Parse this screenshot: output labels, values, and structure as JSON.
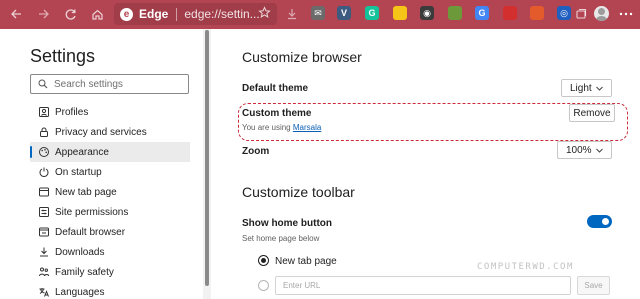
{
  "browser": {
    "brand": "Edge",
    "address_text": "edge://settin...",
    "extensions": [
      {
        "name": "mail-extension-icon",
        "glyph": "✉",
        "color": "#6b6b6b"
      },
      {
        "name": "vpn-extension-icon",
        "glyph": "V",
        "color": "#3d5a80"
      },
      {
        "name": "grammarly-extension-icon",
        "glyph": "G",
        "color": "#15c39a"
      },
      {
        "name": "notes-extension-icon",
        "glyph": "",
        "color": "#f5c518"
      },
      {
        "name": "eye-extension-icon",
        "glyph": "◉",
        "color": "#3b3b3b"
      },
      {
        "name": "palette-extension-icon",
        "glyph": "",
        "color": "#6c9a3a"
      },
      {
        "name": "translate-extension-icon",
        "glyph": "G",
        "color": "#4285f4"
      },
      {
        "name": "flag-extension-icon",
        "glyph": "",
        "color": "#d32f2f"
      },
      {
        "name": "calendar-extension-icon",
        "glyph": "",
        "color": "#e35b2b"
      },
      {
        "name": "circle-extension-icon",
        "glyph": "◎",
        "color": "#1f5fbf"
      }
    ]
  },
  "sidebar": {
    "title": "Settings",
    "search_placeholder": "Search settings",
    "items": [
      {
        "label": "Profiles",
        "icon": "profile-icon",
        "active": false
      },
      {
        "label": "Privacy and services",
        "icon": "lock-icon",
        "active": false
      },
      {
        "label": "Appearance",
        "icon": "palette-icon",
        "active": true
      },
      {
        "label": "On startup",
        "icon": "power-icon",
        "active": false
      },
      {
        "label": "New tab page",
        "icon": "new-tab-icon",
        "active": false
      },
      {
        "label": "Site permissions",
        "icon": "site-permissions-icon",
        "active": false
      },
      {
        "label": "Default browser",
        "icon": "browser-icon",
        "active": false
      },
      {
        "label": "Downloads",
        "icon": "download-icon",
        "active": false
      },
      {
        "label": "Family safety",
        "icon": "family-icon",
        "active": false
      },
      {
        "label": "Languages",
        "icon": "languages-icon",
        "active": false
      }
    ]
  },
  "main": {
    "customize_browser": {
      "heading": "Customize browser",
      "default_theme_label": "Default theme",
      "default_theme_value": "Light",
      "custom_theme_label": "Custom theme",
      "custom_theme_using_prefix": "You are using ",
      "custom_theme_name": "Marsala",
      "remove_label": "Remove",
      "zoom_label": "Zoom",
      "zoom_value": "100%"
    },
    "customize_toolbar": {
      "heading": "Customize toolbar",
      "show_home_label": "Show home button",
      "show_home_sub": "Set home page below",
      "show_home_on": true,
      "new_tab_label": "New tab page",
      "enter_url_placeholder": "Enter URL",
      "save_label": "Save"
    }
  },
  "watermark": "COMPUTERWD.COM",
  "colors": {
    "toolbar": "#b34553",
    "accent": "#0067c0",
    "highlight_border": "#cc2a3a",
    "link": "#0a5fb4"
  }
}
